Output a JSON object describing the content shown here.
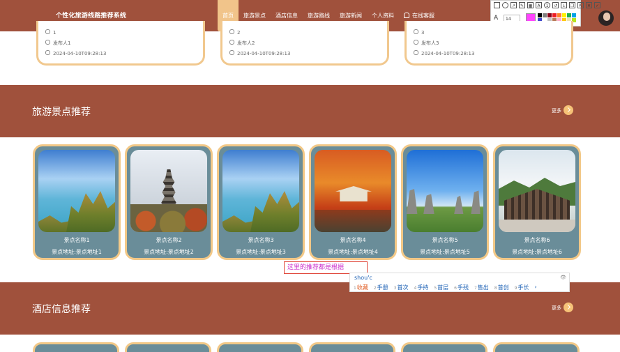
{
  "header": {
    "brand": "个性化旅游线路推荐系统",
    "nav": [
      {
        "label": "首页",
        "active": true
      },
      {
        "label": "旅游景点"
      },
      {
        "label": "酒店信息"
      },
      {
        "label": "旅游路线"
      },
      {
        "label": "旅游新闻"
      },
      {
        "label": "个人资料"
      },
      {
        "label": "在线客服",
        "icon": "bell-icon"
      }
    ]
  },
  "annotation_toolbar": {
    "font_size": "14",
    "current_color": "#ff44ff",
    "tools": [
      "rectangle-icon",
      "circle-icon",
      "arrow-icon",
      "pen-icon",
      "mosaic-icon",
      "text-icon",
      "number-icon",
      "undo-icon",
      "save-icon",
      "copy-icon",
      "pin-icon",
      "cancel-icon",
      "confirm-icon"
    ],
    "swatches": [
      "#000000",
      "#7f7f7f",
      "#880015",
      "#ed1c24",
      "#ff7f27",
      "#fff200",
      "#22b14c",
      "#00a2e8",
      "#3f48cc",
      "#ffffff",
      "#c3c3c3",
      "#b97a57",
      "#ffaec9",
      "#ffc90e",
      "#efe4b0",
      "#b5e61d",
      "#99d9ea",
      "#7092be"
    ]
  },
  "top_cards": [
    {
      "count": "1",
      "publisher": "发布人1",
      "time": "2024-04-10T09:28:13"
    },
    {
      "count": "2",
      "publisher": "发布人2",
      "time": "2024-04-10T09:28:13"
    },
    {
      "count": "3",
      "publisher": "发布人3",
      "time": "2024-04-10T09:28:13"
    }
  ],
  "sections": {
    "attractions": {
      "title": "旅游景点推荐",
      "more": "更多"
    },
    "hotels": {
      "title": "酒店信息推荐",
      "more": "更多"
    }
  },
  "attractions": [
    {
      "name": "景点名称1",
      "address": "景点地址:景点地址1",
      "image": "coast-cliff"
    },
    {
      "name": "景点名称2",
      "address": "景点地址:景点地址2",
      "image": "pagoda"
    },
    {
      "name": "景点名称3",
      "address": "景点地址:景点地址3",
      "image": "coast-cliff"
    },
    {
      "name": "景点名称4",
      "address": "景点地址:景点地址4",
      "image": "autumn-pavilion"
    },
    {
      "name": "景点名称5",
      "address": "景点地址:景点地址5",
      "image": "stone-forest"
    },
    {
      "name": "景点名称6",
      "address": "景点地址:景点地址6",
      "image": "mountain-gate"
    }
  ],
  "text_annotation": {
    "text": "这里的推荐都是根据"
  },
  "ime": {
    "input": "shou'c",
    "candidates": [
      "收藏",
      "手册",
      "首次",
      "手持",
      "首层",
      "手残",
      "售出",
      "首创",
      "手长"
    ]
  }
}
